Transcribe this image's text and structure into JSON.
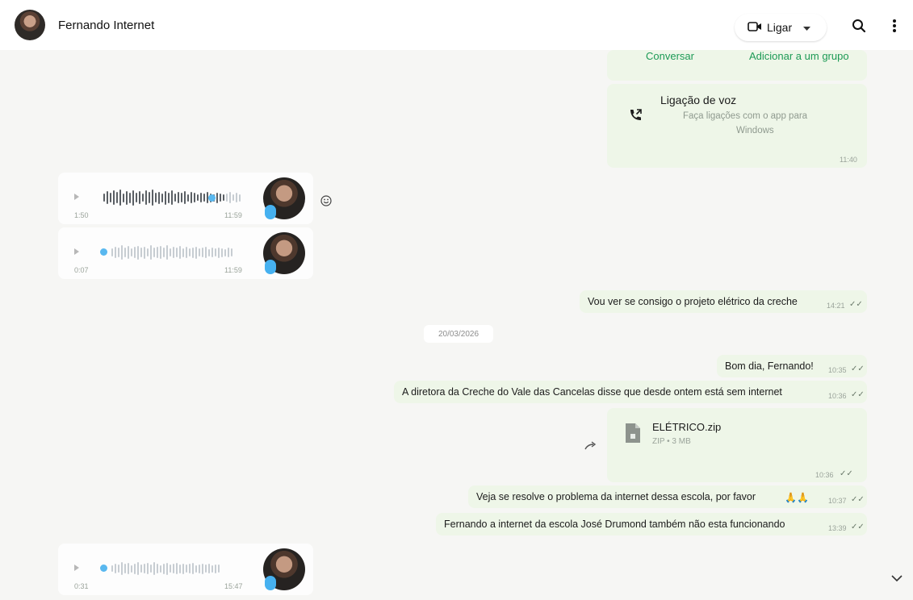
{
  "header": {
    "contact_name": "Fernando Internet",
    "call_label": "Ligar"
  },
  "contact_card": {
    "chat_button": "Conversar",
    "add_group_button": "Adicionar a um grupo"
  },
  "voice_call": {
    "title": "Ligação de voz",
    "description_line1": "Faça ligações com o app para",
    "description_line2": "Windows",
    "time": "11:40"
  },
  "voice_notes": [
    {
      "duration": "1:50",
      "time": "11:59"
    },
    {
      "duration": "0:07",
      "time": "11:59"
    },
    {
      "duration": "0:31",
      "time": "15:47"
    }
  ],
  "date_separator": "20/03/2026",
  "messages": [
    {
      "text": "Vou ver se consigo o projeto elétrico da creche",
      "time": "14:21"
    },
    {
      "text": "Bom dia, Fernando!",
      "time": "10:35"
    },
    {
      "text": "A diretora da Creche do Vale das Cancelas disse que desde ontem está sem internet",
      "time": "10:36"
    },
    {
      "text": "Veja se resolve o problema da internet dessa escola, por favor",
      "time": "10:37"
    },
    {
      "text": "Fernando a internet da escola José Drumond também não esta funcionando",
      "time": "13:39"
    }
  ],
  "file": {
    "name": "ELÉTRICO.zip",
    "meta": "ZIP • 3 MB",
    "time": "10:36"
  },
  "colors": {
    "accent": "#1c9a55",
    "outgoing_bubble": "#eef6e8",
    "mic": "#46b1f0"
  }
}
